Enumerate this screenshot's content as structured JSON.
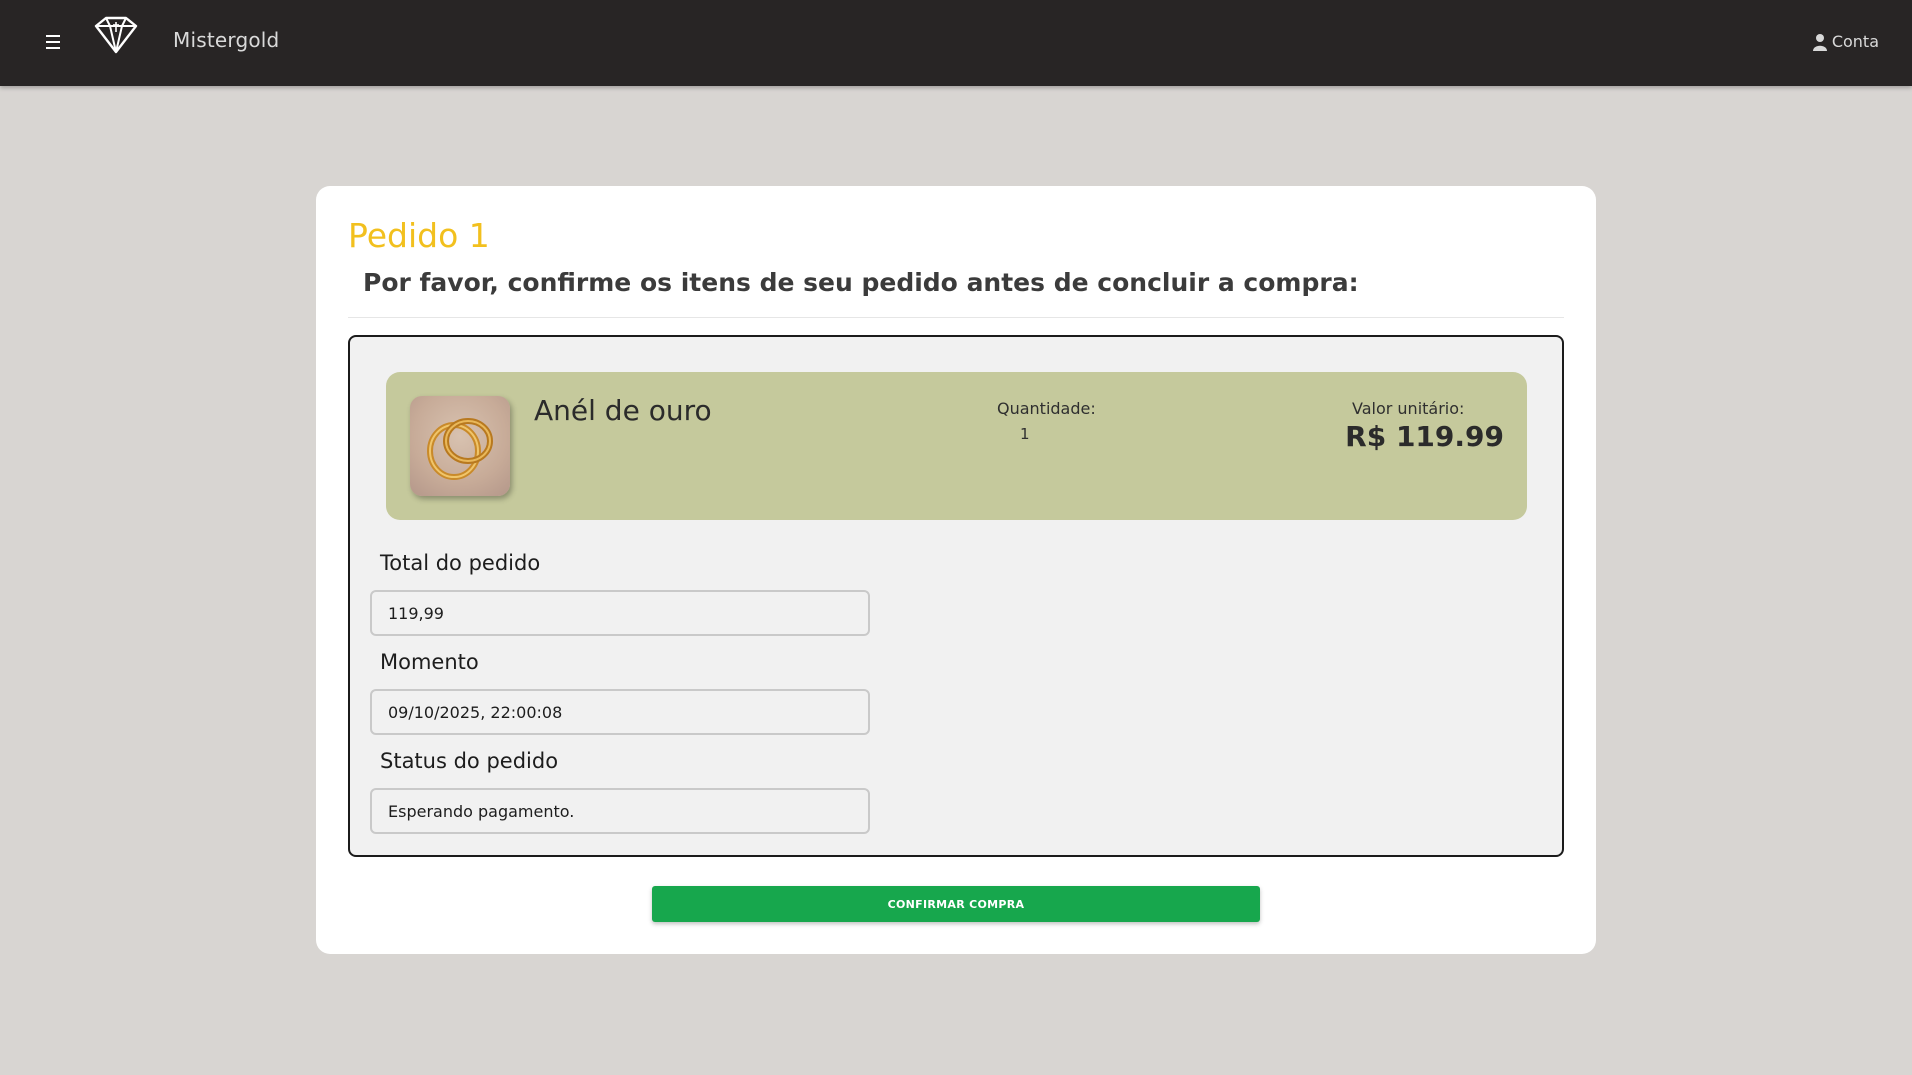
{
  "navbar": {
    "brand": "Mistergold",
    "account_label": "Conta"
  },
  "order": {
    "title": "Pedido 1",
    "subtitle": "Por favor, confirme os itens de seu pedido antes de concluir a compra:"
  },
  "items": [
    {
      "name": "Anél de ouro",
      "quantity_label": "Quantidade:",
      "quantity": "1",
      "price_label": "Valor unitário:",
      "price": "R$ 119.99",
      "image_icon": "gold-rings-image"
    }
  ],
  "fields": {
    "total_label": "Total do pedido",
    "total_value": "119,99",
    "moment_label": "Momento",
    "moment_value": "09/10/2025, 22:00:08",
    "status_label": "Status do pedido",
    "status_value": "Esperando pagamento."
  },
  "actions": {
    "confirm_label": "CONFIRMAR COMPRA"
  },
  "colors": {
    "navbar_bg": "#282525",
    "page_bg": "#d8d5d2",
    "title_accent": "#f2c01e",
    "item_card_bg": "#c5c99c",
    "confirm_button": "#17a74d"
  }
}
